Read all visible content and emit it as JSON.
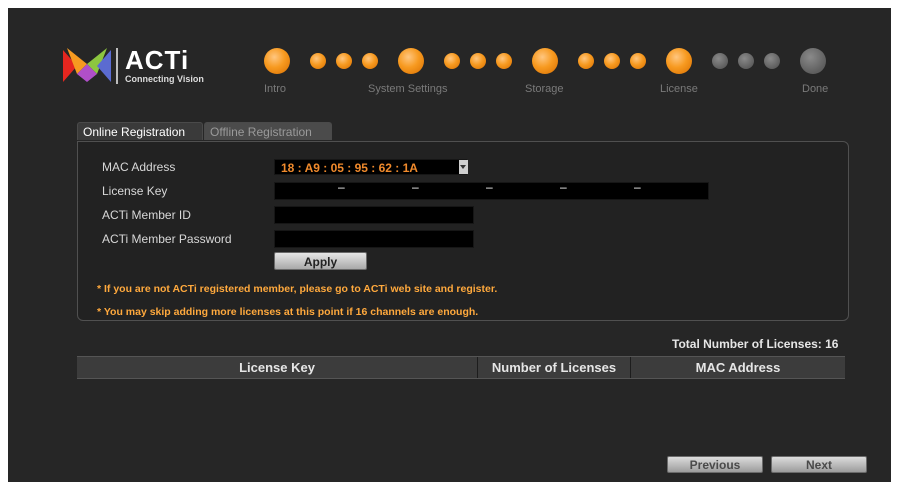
{
  "logo": {
    "brand": "ACTi",
    "tagline": "Connecting Vision"
  },
  "wizard": {
    "steps": [
      "Intro",
      "System Settings",
      "Storage",
      "License",
      "Done"
    ]
  },
  "tabs": {
    "online": "Online Registration",
    "offline": "Offline Registration"
  },
  "form": {
    "mac_label": "MAC Address",
    "mac_value": "18 : A9 : 05 : 95 : 62 : 1A",
    "license_key_label": "License Key",
    "license_key_separator": "–",
    "member_id_label": "ACTi Member ID",
    "member_password_label": "ACTi Member Password",
    "apply_label": "Apply"
  },
  "notes": {
    "register": "* If you are not ACTi registered member, please go to ACTi web site and register.",
    "skip": "* You may skip adding more licenses at this point if 16 channels are enough."
  },
  "total_licenses": "Total Number of Licenses: 16",
  "table": {
    "columns": [
      "License Key",
      "Number of Licenses",
      "MAC Address"
    ]
  },
  "nav": {
    "previous": "Previous",
    "next": "Next"
  },
  "colors": {
    "accent_orange": "#f79a20",
    "note_text": "#ffa93d",
    "mac_text": "#f08a2c"
  }
}
